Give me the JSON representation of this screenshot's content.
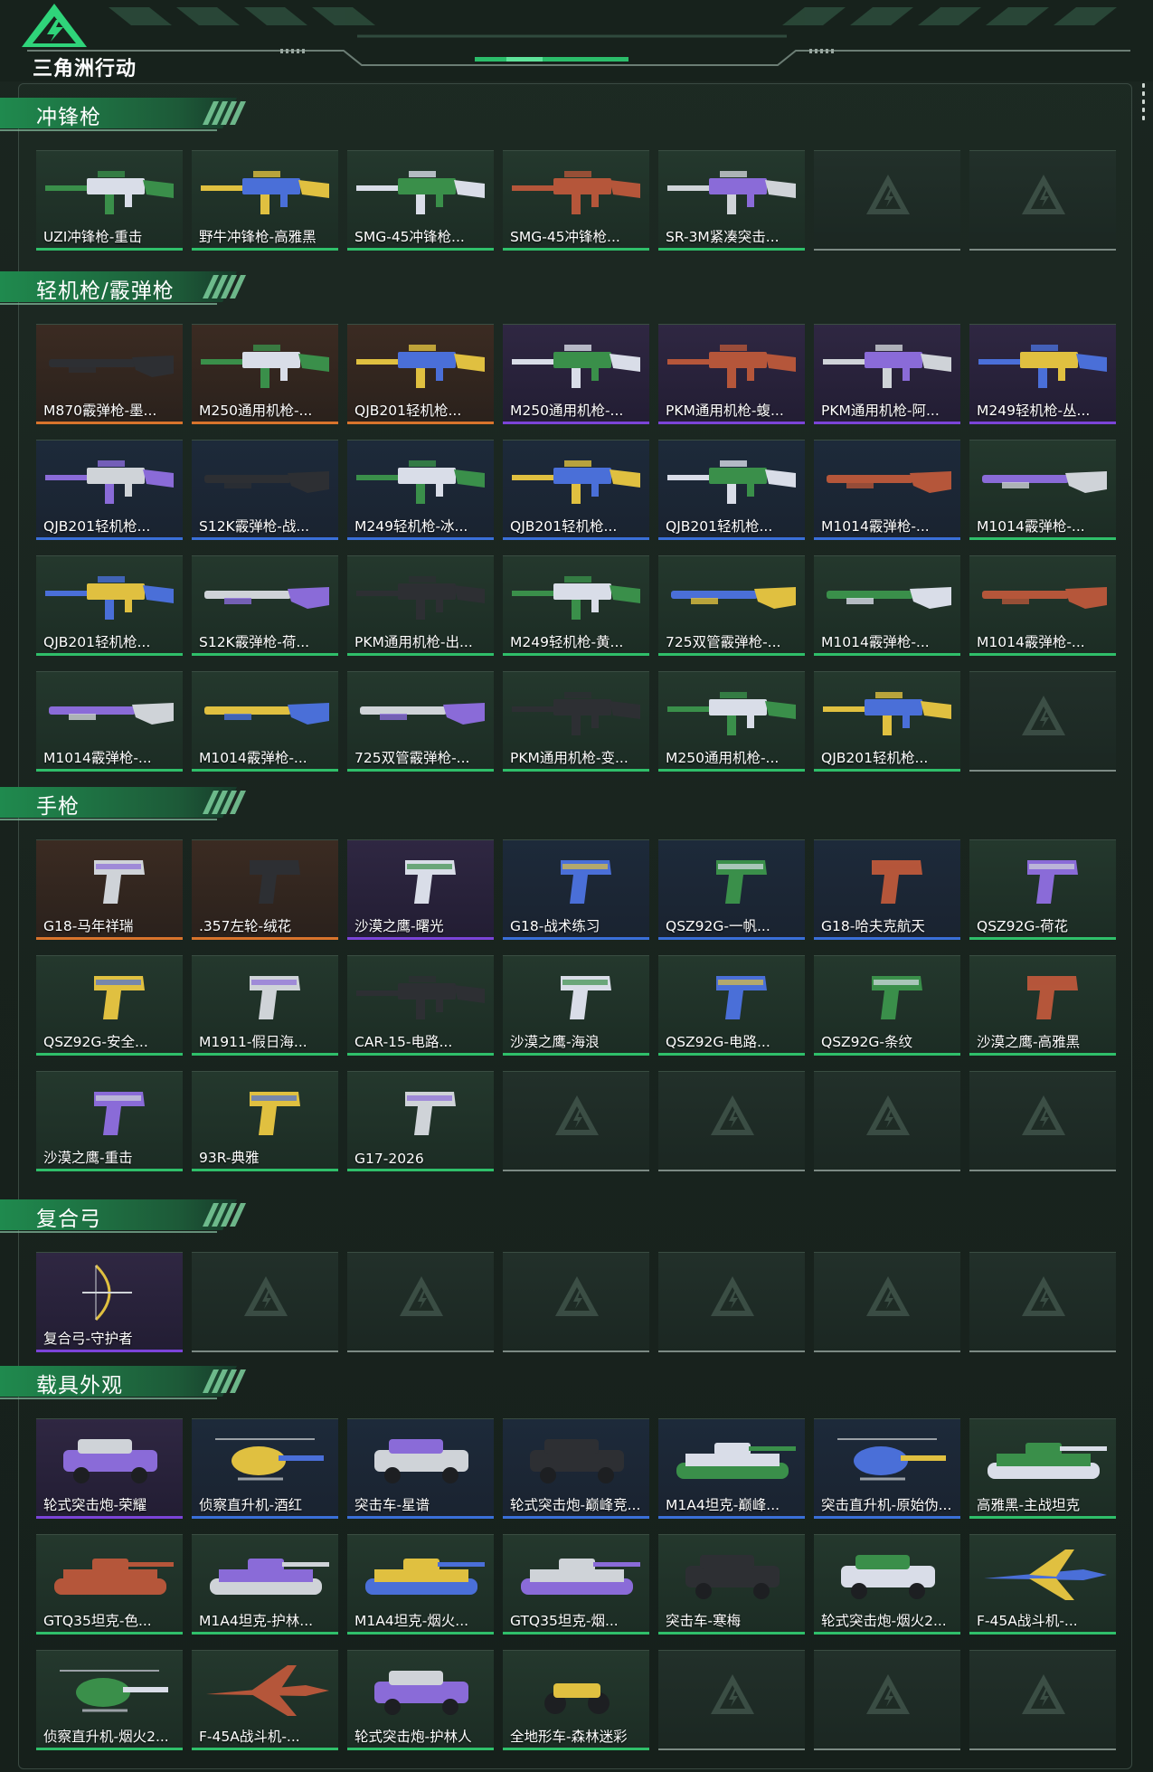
{
  "app": {
    "title": "三角洲行动"
  },
  "colors": {
    "accent": "#27c46b",
    "bar_green": "#2fbf6a",
    "bar_blue": "#3a6fd8",
    "bar_purple": "#7b44d8",
    "bar_orange": "#d8742c",
    "bar_empty": "#7c8a84"
  },
  "sections": [
    {
      "title": "冲锋枪",
      "items": [
        {
          "name": "UZI冲锋枪-重击",
          "quality": "green",
          "icon": "smg-icon"
        },
        {
          "name": "野牛冲锋枪-高雅黑",
          "quality": "green",
          "icon": "smg-icon"
        },
        {
          "name": "SMG-45冲锋枪...",
          "quality": "green",
          "icon": "smg-icon"
        },
        {
          "name": "SMG-45冲锋枪...",
          "quality": "green",
          "icon": "smg-icon"
        },
        {
          "name": "SR-3M紧凑突击...",
          "quality": "green",
          "icon": "smg-icon"
        },
        {
          "name": "",
          "quality": "empty"
        },
        {
          "name": "",
          "quality": "empty"
        }
      ]
    },
    {
      "title": "轻机枪/霰弹枪",
      "items": [
        {
          "name": "M870霰弹枪-墨...",
          "quality": "orange",
          "icon": "shotgun-icon"
        },
        {
          "name": "M250通用机枪-...",
          "quality": "orange",
          "icon": "machine-gun-icon"
        },
        {
          "name": "QJB201轻机枪...",
          "quality": "orange",
          "icon": "machine-gun-icon"
        },
        {
          "name": "M250通用机枪-...",
          "quality": "purple",
          "icon": "machine-gun-icon"
        },
        {
          "name": "PKM通用机枪-蝮...",
          "quality": "purple",
          "icon": "machine-gun-icon"
        },
        {
          "name": "PKM通用机枪-阿...",
          "quality": "purple",
          "icon": "machine-gun-icon"
        },
        {
          "name": "M249轻机枪-丛...",
          "quality": "purple",
          "icon": "machine-gun-icon"
        },
        {
          "name": "QJB201轻机枪...",
          "quality": "blue",
          "icon": "machine-gun-icon"
        },
        {
          "name": "S12K霰弹枪-战...",
          "quality": "blue",
          "icon": "shotgun-icon"
        },
        {
          "name": "M249轻机枪-冰...",
          "quality": "blue",
          "icon": "machine-gun-icon"
        },
        {
          "name": "QJB201轻机枪...",
          "quality": "blue",
          "icon": "machine-gun-icon"
        },
        {
          "name": "QJB201轻机枪...",
          "quality": "blue",
          "icon": "machine-gun-icon"
        },
        {
          "name": "M1014霰弹枪-...",
          "quality": "blue",
          "icon": "shotgun-icon"
        },
        {
          "name": "M1014霰弹枪-...",
          "quality": "green",
          "icon": "shotgun-icon"
        },
        {
          "name": "QJB201轻机枪...",
          "quality": "green",
          "icon": "machine-gun-icon"
        },
        {
          "name": "S12K霰弹枪-荷...",
          "quality": "green",
          "icon": "shotgun-icon"
        },
        {
          "name": "PKM通用机枪-出...",
          "quality": "green",
          "icon": "machine-gun-icon"
        },
        {
          "name": "M249轻机枪-黄...",
          "quality": "green",
          "icon": "machine-gun-icon"
        },
        {
          "name": "725双管霰弹枪-...",
          "quality": "green",
          "icon": "shotgun-icon"
        },
        {
          "name": "M1014霰弹枪-...",
          "quality": "green",
          "icon": "shotgun-icon"
        },
        {
          "name": "M1014霰弹枪-...",
          "quality": "green",
          "icon": "shotgun-icon"
        },
        {
          "name": "M1014霰弹枪-...",
          "quality": "green",
          "icon": "shotgun-icon"
        },
        {
          "name": "M1014霰弹枪-...",
          "quality": "green",
          "icon": "shotgun-icon"
        },
        {
          "name": "725双管霰弹枪-...",
          "quality": "green",
          "icon": "shotgun-icon"
        },
        {
          "name": "PKM通用机枪-变...",
          "quality": "green",
          "icon": "machine-gun-icon"
        },
        {
          "name": "M250通用机枪-...",
          "quality": "green",
          "icon": "machine-gun-icon"
        },
        {
          "name": "QJB201轻机枪...",
          "quality": "green",
          "icon": "machine-gun-icon"
        },
        {
          "name": "",
          "quality": "empty"
        }
      ]
    },
    {
      "title": "手枪",
      "items": [
        {
          "name": "G18-马年祥瑞",
          "quality": "orange",
          "icon": "pistol-icon"
        },
        {
          "name": ".357左轮-绒花",
          "quality": "orange",
          "icon": "revolver-icon"
        },
        {
          "name": "沙漠之鹰-曙光",
          "quality": "purple",
          "icon": "pistol-icon"
        },
        {
          "name": "G18-战术练习",
          "quality": "blue",
          "icon": "pistol-icon"
        },
        {
          "name": "QSZ92G-一帆...",
          "quality": "blue",
          "icon": "pistol-icon"
        },
        {
          "name": "G18-哈夫克航天",
          "quality": "blue",
          "icon": "pistol-icon"
        },
        {
          "name": "QSZ92G-荷花",
          "quality": "green",
          "icon": "pistol-icon"
        },
        {
          "name": "QSZ92G-安全...",
          "quality": "green",
          "icon": "pistol-icon"
        },
        {
          "name": "M1911-假日海...",
          "quality": "green",
          "icon": "pistol-icon"
        },
        {
          "name": "CAR-15-电路...",
          "quality": "green",
          "icon": "rifle-icon"
        },
        {
          "name": "沙漠之鹰-海浪",
          "quality": "green",
          "icon": "pistol-icon"
        },
        {
          "name": "QSZ92G-电路...",
          "quality": "green",
          "icon": "pistol-icon"
        },
        {
          "name": "QSZ92G-条纹",
          "quality": "green",
          "icon": "pistol-icon"
        },
        {
          "name": "沙漠之鹰-高雅黑",
          "quality": "green",
          "icon": "pistol-icon"
        },
        {
          "name": "沙漠之鹰-重击",
          "quality": "green",
          "icon": "pistol-icon"
        },
        {
          "name": "93R-典雅",
          "quality": "green",
          "icon": "pistol-icon"
        },
        {
          "name": "G17-2026",
          "quality": "green",
          "icon": "pistol-icon"
        },
        {
          "name": "",
          "quality": "empty"
        },
        {
          "name": "",
          "quality": "empty"
        },
        {
          "name": "",
          "quality": "empty"
        },
        {
          "name": "",
          "quality": "empty"
        }
      ]
    },
    {
      "title": "复合弓",
      "items": [
        {
          "name": "复合弓-守护者",
          "quality": "purple",
          "icon": "bow-icon"
        },
        {
          "name": "",
          "quality": "empty"
        },
        {
          "name": "",
          "quality": "empty"
        },
        {
          "name": "",
          "quality": "empty"
        },
        {
          "name": "",
          "quality": "empty"
        },
        {
          "name": "",
          "quality": "empty"
        },
        {
          "name": "",
          "quality": "empty"
        }
      ]
    },
    {
      "title": "载具外观",
      "items": [
        {
          "name": "轮式突击炮-荣耀",
          "quality": "purple",
          "icon": "vehicle-icon"
        },
        {
          "name": "侦察直升机-酒红",
          "quality": "blue",
          "icon": "helicopter-icon"
        },
        {
          "name": "突击车-星谱",
          "quality": "blue",
          "icon": "vehicle-icon"
        },
        {
          "name": "轮式突击炮-巅峰竞...",
          "quality": "blue",
          "icon": "vehicle-icon"
        },
        {
          "name": "M1A4坦克-巅峰...",
          "quality": "blue",
          "icon": "tank-icon"
        },
        {
          "name": "突击直升机-原始伪...",
          "quality": "blue",
          "icon": "helicopter-icon"
        },
        {
          "name": "高雅黑-主战坦克",
          "quality": "green",
          "icon": "tank-icon"
        },
        {
          "name": "GTQ35坦克-色...",
          "quality": "green",
          "icon": "tank-icon"
        },
        {
          "name": "M1A4坦克-护林...",
          "quality": "green",
          "icon": "tank-icon"
        },
        {
          "name": "M1A4坦克-烟火...",
          "quality": "green",
          "icon": "tank-icon"
        },
        {
          "name": "GTQ35坦克-烟...",
          "quality": "green",
          "icon": "tank-icon"
        },
        {
          "name": "突击车-寒梅",
          "quality": "green",
          "icon": "vehicle-icon"
        },
        {
          "name": "轮式突击炮-烟火2...",
          "quality": "green",
          "icon": "vehicle-icon"
        },
        {
          "name": "F-45A战斗机-...",
          "quality": "green",
          "icon": "jet-icon"
        },
        {
          "name": "侦察直升机-烟火2...",
          "quality": "green",
          "icon": "helicopter-icon"
        },
        {
          "name": "F-45A战斗机-...",
          "quality": "green",
          "icon": "jet-icon"
        },
        {
          "name": "轮式突击炮-护林人",
          "quality": "green",
          "icon": "vehicle-icon"
        },
        {
          "name": "全地形车-森林迷彩",
          "quality": "green",
          "icon": "atv-icon"
        },
        {
          "name": "",
          "quality": "empty"
        },
        {
          "name": "",
          "quality": "empty"
        },
        {
          "name": "",
          "quality": "empty"
        }
      ]
    }
  ]
}
